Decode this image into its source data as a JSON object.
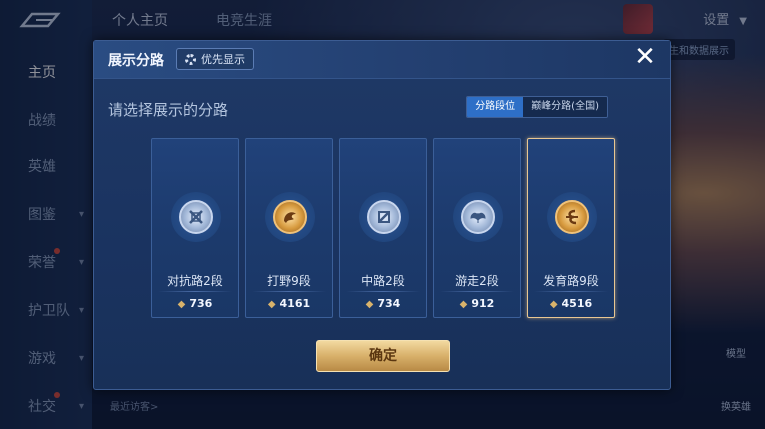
{
  "nav": {
    "items": [
      {
        "label": "主页",
        "active": true,
        "chevron": false,
        "dot": false
      },
      {
        "label": "战绩",
        "active": false,
        "chevron": false,
        "dot": false
      },
      {
        "label": "英雄",
        "active": false,
        "chevron": false,
        "dot": false
      },
      {
        "label": "图鉴",
        "active": false,
        "chevron": true,
        "dot": false
      },
      {
        "label": "荣誉",
        "active": false,
        "chevron": true,
        "dot": true
      },
      {
        "label": "护卫队",
        "active": false,
        "chevron": true,
        "dot": false
      },
      {
        "label": "游戏",
        "active": false,
        "chevron": true,
        "dot": false
      },
      {
        "label": "社交",
        "active": false,
        "chevron": true,
        "dot": true
      }
    ]
  },
  "topbar": {
    "tabs": [
      "个人主页",
      "电竞生涯"
    ],
    "settings_label": "设置",
    "chip_label": "生和数据展示"
  },
  "right_side": {
    "model_label": "模型",
    "hero_label": "换英雄"
  },
  "footer": {
    "recent_label": "最近访客>"
  },
  "modal": {
    "title": "展示分路",
    "priority_button": "优先显示",
    "prompt": "请选择展示的分路",
    "segment": {
      "options": [
        "分路段位",
        "巅峰分路(全国)"
      ],
      "active_index": 0
    },
    "cards": [
      {
        "label": "对抗路2段",
        "score": "736",
        "tier": "silver",
        "icon": "sword-shield-icon",
        "selected": false
      },
      {
        "label": "打野9段",
        "score": "4161",
        "tier": "gold",
        "icon": "dragon-icon",
        "selected": false
      },
      {
        "label": "中路2段",
        "score": "734",
        "tier": "silver",
        "icon": "staff-icon",
        "selected": false
      },
      {
        "label": "游走2段",
        "score": "912",
        "tier": "silver",
        "icon": "wings-icon",
        "selected": false
      },
      {
        "label": "发育路9段",
        "score": "4516",
        "tier": "gold",
        "icon": "bow-icon",
        "selected": true
      }
    ],
    "confirm_label": "确定"
  },
  "colors": {
    "accent_blue": "#2e6fc7",
    "gold": "#d8b06a",
    "panel": "#1f3966"
  }
}
